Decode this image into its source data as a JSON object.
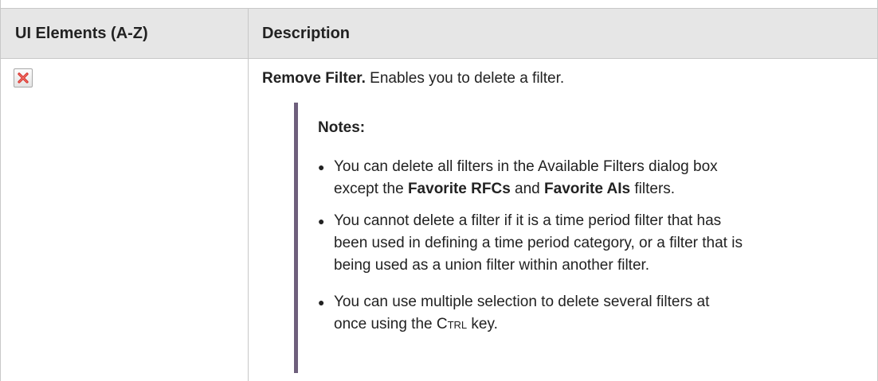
{
  "table": {
    "header": {
      "elements": "UI Elements (A-Z)",
      "description": "Description"
    },
    "row": {
      "icon": "remove-filter-icon",
      "title": "Remove Filter.",
      "summary": " Enables you to delete a filter.",
      "notes_title": "Notes:",
      "notes": [
        {
          "parts": [
            "You can delete all filters in the Available Filters dialog box",
            "except the ",
            "Favorite RFCs",
            " and ",
            "Favorite AIs",
            " filters."
          ]
        },
        {
          "lines": [
            "You cannot delete a filter if it is a time period filter that has",
            "been used in defining a time period category, or a filter that is",
            "being used as a union filter within another filter."
          ]
        },
        {
          "parts": [
            "You can use multiple selection to delete several filters at",
            "once using the ",
            "Ctrl",
            " key."
          ]
        }
      ]
    }
  },
  "colors": {
    "header_bg": "#e6e6e6",
    "notes_bar": "#6e5f7c",
    "icon_red": "#d9302b"
  }
}
